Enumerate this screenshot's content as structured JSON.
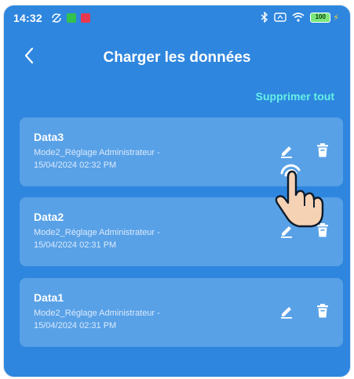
{
  "status_bar": {
    "time": "14:32",
    "battery": "100"
  },
  "header": {
    "title": "Charger les données",
    "back_icon": "chevron-left-icon"
  },
  "actions": {
    "delete_all": "Supprimer tout"
  },
  "items": [
    {
      "name": "Data3",
      "description": "Mode2_Réglage Administrateur -",
      "date": "15/04/2024 02:32 PM",
      "edit_icon": "pencil-icon",
      "delete_icon": "trash-icon"
    },
    {
      "name": "Data2",
      "description": "Mode2_Réglage Administrateur -",
      "date": "15/04/2024 02:31 PM",
      "edit_icon": "pencil-icon",
      "delete_icon": "trash-icon"
    },
    {
      "name": "Data1",
      "description": "Mode2_Réglage Administrateur -",
      "date": "15/04/2024 02:31 PM",
      "edit_icon": "pencil-icon",
      "delete_icon": "trash-icon"
    }
  ],
  "colors": {
    "background": "#2e86de",
    "card": "#58a1e7",
    "accent": "#64f0e6"
  }
}
